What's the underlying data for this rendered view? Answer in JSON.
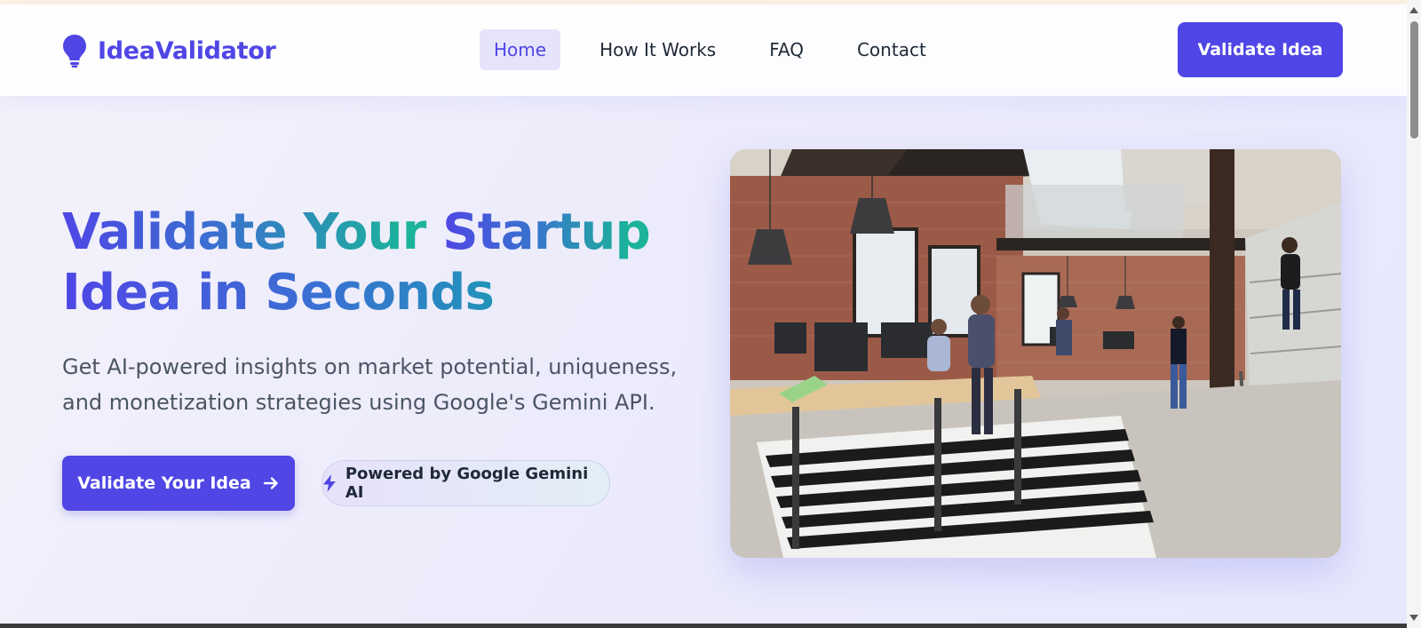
{
  "brand": {
    "name": "IdeaValidator",
    "icon": "lightbulb-icon",
    "color": "#4f46e5"
  },
  "nav": {
    "links": [
      {
        "label": "Home",
        "active": true
      },
      {
        "label": "How It Works",
        "active": false
      },
      {
        "label": "FAQ",
        "active": false
      },
      {
        "label": "Contact",
        "active": false
      }
    ],
    "cta_label": "Validate Idea"
  },
  "hero": {
    "title_part1": "Validate Your ",
    "title_part2": "Startup",
    "title_line2": "Idea in Seconds",
    "subtitle": "Get AI-powered insights on market potential, uniqueness, and monetization strategies using Google's Gemini API.",
    "primary_button": "Validate Your Idea",
    "primary_button_icon": "arrow-right-icon",
    "badge_label": "Powered by Google Gemini AI",
    "badge_icon": "bolt-icon"
  },
  "image": {
    "subject": "office-workspace-photo"
  },
  "colors": {
    "accent": "#4f46e5",
    "gradient_end": "#1bb39a",
    "text": "#1f2937",
    "muted": "#4b5563"
  }
}
